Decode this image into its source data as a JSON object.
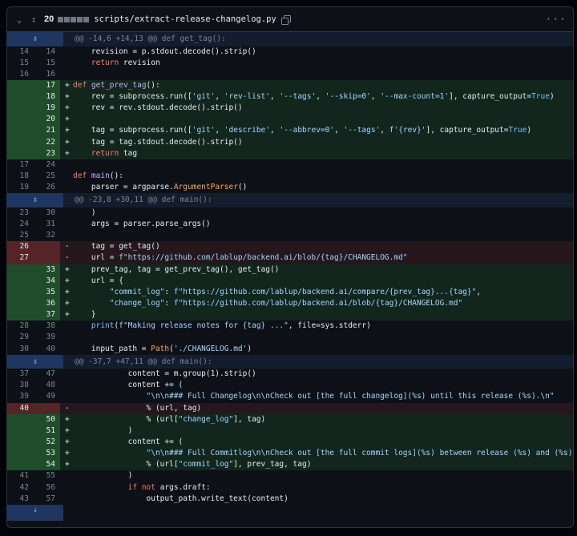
{
  "header": {
    "changes_count": "20",
    "file_path": "scripts/extract-release-changelog.py",
    "more_label": "···",
    "icons": [
      "chevron-down-icon",
      "unfold-icon",
      "copy-icon",
      "kebab-icon"
    ]
  },
  "colors": {
    "addition_bg": "#12261e",
    "addition_gutter": "#1f4d2b",
    "deletion_bg": "#25171c",
    "deletion_gutter": "#542426",
    "hunk_bg": "#131d2e",
    "keyword": "#ff7b72",
    "function": "#d2a8ff",
    "string": "#a5d6ff"
  },
  "lines": [
    {
      "type": "hunk",
      "text": "@@ -14,6 +14,13 @@ def get_tag():"
    },
    {
      "type": "ctx",
      "old": "14",
      "new": "14",
      "sign": "",
      "code": [
        [
          "",
          "    revision = p.stdout.decode().strip()"
        ]
      ]
    },
    {
      "type": "ctx",
      "old": "15",
      "new": "15",
      "sign": "",
      "code": [
        [
          "",
          "    "
        ],
        [
          "kw",
          "return"
        ],
        [
          "",
          " revision"
        ]
      ]
    },
    {
      "type": "ctx",
      "old": "16",
      "new": "16",
      "sign": "",
      "code": [
        [
          "",
          ""
        ]
      ]
    },
    {
      "type": "add",
      "old": "",
      "new": "17",
      "sign": "+",
      "code": [
        [
          "kw",
          "def"
        ],
        [
          "",
          " "
        ],
        [
          "fn",
          "get_prev_tag"
        ],
        [
          "",
          "():"
        ]
      ]
    },
    {
      "type": "add",
      "old": "",
      "new": "18",
      "sign": "+",
      "code": [
        [
          "",
          "    rev = subprocess.run(["
        ],
        [
          "st",
          "'git'"
        ],
        [
          "",
          ", "
        ],
        [
          "st",
          "'rev-list'"
        ],
        [
          "",
          ", "
        ],
        [
          "st",
          "'--tags'"
        ],
        [
          "",
          ", "
        ],
        [
          "st",
          "'--skip=0'"
        ],
        [
          "",
          ", "
        ],
        [
          "st",
          "'--max-count=1'"
        ],
        [
          "",
          "], capture_output="
        ],
        [
          "co",
          "True"
        ],
        [
          "",
          ")"
        ]
      ]
    },
    {
      "type": "add",
      "old": "",
      "new": "19",
      "sign": "+",
      "code": [
        [
          "",
          "    rev = rev.stdout.decode().strip()"
        ]
      ]
    },
    {
      "type": "add",
      "old": "",
      "new": "20",
      "sign": "+",
      "code": [
        [
          "",
          ""
        ]
      ]
    },
    {
      "type": "add",
      "old": "",
      "new": "21",
      "sign": "+",
      "code": [
        [
          "",
          "    tag = subprocess.run(["
        ],
        [
          "st",
          "'git'"
        ],
        [
          "",
          ", "
        ],
        [
          "st",
          "'describe'"
        ],
        [
          "",
          ", "
        ],
        [
          "st",
          "'--abbrev=0'"
        ],
        [
          "",
          ", "
        ],
        [
          "st",
          "'--tags'"
        ],
        [
          "",
          ", "
        ],
        [
          "st",
          "f'{rev}'"
        ],
        [
          "",
          "], capture_output="
        ],
        [
          "co",
          "True"
        ],
        [
          "",
          ")"
        ]
      ]
    },
    {
      "type": "add",
      "old": "",
      "new": "22",
      "sign": "+",
      "code": [
        [
          "",
          "    tag = tag.stdout.decode().strip()"
        ]
      ]
    },
    {
      "type": "add",
      "old": "",
      "new": "23",
      "sign": "+",
      "code": [
        [
          "",
          "    "
        ],
        [
          "kw",
          "return"
        ],
        [
          "",
          " tag"
        ]
      ]
    },
    {
      "type": "ctx",
      "old": "17",
      "new": "24",
      "sign": "",
      "code": [
        [
          "",
          ""
        ]
      ]
    },
    {
      "type": "ctx",
      "old": "18",
      "new": "25",
      "sign": "",
      "code": [
        [
          "kw",
          "def"
        ],
        [
          "",
          " "
        ],
        [
          "fn",
          "main"
        ],
        [
          "",
          "():"
        ]
      ]
    },
    {
      "type": "ctx",
      "old": "19",
      "new": "26",
      "sign": "",
      "code": [
        [
          "",
          "    parser = argparse."
        ],
        [
          "cl",
          "ArgumentParser"
        ],
        [
          "",
          "()"
        ]
      ]
    },
    {
      "type": "hunk",
      "text": "@@ -23,8 +30,11 @@ def main():"
    },
    {
      "type": "ctx",
      "old": "23",
      "new": "30",
      "sign": "",
      "code": [
        [
          "",
          "    )"
        ]
      ]
    },
    {
      "type": "ctx",
      "old": "24",
      "new": "31",
      "sign": "",
      "code": [
        [
          "",
          "    args = parser.parse_args()"
        ]
      ]
    },
    {
      "type": "ctx",
      "old": "25",
      "new": "32",
      "sign": "",
      "code": [
        [
          "",
          ""
        ]
      ]
    },
    {
      "type": "del",
      "old": "26",
      "new": "",
      "sign": "-",
      "code": [
        [
          "",
          "    tag = get_tag()"
        ]
      ]
    },
    {
      "type": "del",
      "old": "27",
      "new": "",
      "sign": "-",
      "code": [
        [
          "",
          "    url = "
        ],
        [
          "st",
          "f\"https://github.com/lablup/backend.ai/blob/{tag}/CHANGELOG.md\""
        ]
      ]
    },
    {
      "type": "add",
      "old": "",
      "new": "33",
      "sign": "+",
      "code": [
        [
          "",
          "    prev_tag, tag = get_prev_tag(), get_tag()"
        ]
      ]
    },
    {
      "type": "add",
      "old": "",
      "new": "34",
      "sign": "+",
      "code": [
        [
          "",
          "    url = {"
        ]
      ]
    },
    {
      "type": "add",
      "old": "",
      "new": "35",
      "sign": "+",
      "code": [
        [
          "",
          "        "
        ],
        [
          "st",
          "\"commit_log\""
        ],
        [
          "",
          ": "
        ],
        [
          "st",
          "f\"https://github.com/lablup/backend.ai/compare/{prev_tag}...{tag}\""
        ],
        [
          "",
          ","
        ]
      ]
    },
    {
      "type": "add",
      "old": "",
      "new": "36",
      "sign": "+",
      "code": [
        [
          "",
          "        "
        ],
        [
          "st",
          "\"change_log\""
        ],
        [
          "",
          ": "
        ],
        [
          "st",
          "f\"https://github.com/lablup/backend.ai/blob/{tag}/CHANGELOG.md\""
        ]
      ]
    },
    {
      "type": "add",
      "old": "",
      "new": "37",
      "sign": "+",
      "code": [
        [
          "",
          "    }"
        ]
      ]
    },
    {
      "type": "ctx",
      "old": "28",
      "new": "38",
      "sign": "",
      "code": [
        [
          "",
          "    "
        ],
        [
          "co",
          "print"
        ],
        [
          "",
          "("
        ],
        [
          "st",
          "f\"Making release notes for {tag} ...\""
        ],
        [
          "",
          ", file=sys.stderr)"
        ]
      ]
    },
    {
      "type": "ctx",
      "old": "29",
      "new": "39",
      "sign": "",
      "code": [
        [
          "",
          ""
        ]
      ]
    },
    {
      "type": "ctx",
      "old": "30",
      "new": "40",
      "sign": "",
      "code": [
        [
          "",
          "    input_path = "
        ],
        [
          "cl",
          "Path"
        ],
        [
          "",
          "("
        ],
        [
          "st",
          "'./CHANGELOG.md'"
        ],
        [
          "",
          ")"
        ]
      ]
    },
    {
      "type": "hunk",
      "text": "@@ -37,7 +47,11 @@ def main():"
    },
    {
      "type": "ctx",
      "old": "37",
      "new": "47",
      "sign": "",
      "code": [
        [
          "",
          "            content = m.group(1).strip()"
        ]
      ]
    },
    {
      "type": "ctx",
      "old": "38",
      "new": "48",
      "sign": "",
      "code": [
        [
          "",
          "            content += ("
        ]
      ]
    },
    {
      "type": "ctx",
      "old": "39",
      "new": "49",
      "sign": "",
      "code": [
        [
          "",
          "                "
        ],
        [
          "st",
          "\"\\n\\n### Full Changelog\\n\\nCheck out [the full changelog](%s) until this release (%s).\\n\""
        ]
      ]
    },
    {
      "type": "del",
      "old": "40",
      "new": "",
      "sign": "-",
      "code": [
        [
          "",
          "                % (url, tag)"
        ]
      ]
    },
    {
      "type": "add",
      "old": "",
      "new": "50",
      "sign": "+",
      "code": [
        [
          "",
          "                % (url["
        ],
        [
          "st",
          "\"change_log\""
        ],
        [
          "",
          "], tag)"
        ]
      ]
    },
    {
      "type": "add",
      "old": "",
      "new": "51",
      "sign": "+",
      "code": [
        [
          "",
          "            )"
        ]
      ]
    },
    {
      "type": "add",
      "old": "",
      "new": "52",
      "sign": "+",
      "code": [
        [
          "",
          "            content += ("
        ]
      ]
    },
    {
      "type": "add",
      "old": "",
      "new": "53",
      "sign": "+",
      "code": [
        [
          "",
          "                "
        ],
        [
          "st",
          "\"\\n\\n### Full Commitlog\\n\\nCheck out [the full commit logs](%s) between release (%s) and (%s).\\n\""
        ]
      ]
    },
    {
      "type": "add",
      "old": "",
      "new": "54",
      "sign": "+",
      "code": [
        [
          "",
          "                % (url["
        ],
        [
          "st",
          "\"commit_log\""
        ],
        [
          "",
          "], prev_tag, tag)"
        ]
      ]
    },
    {
      "type": "ctx",
      "old": "41",
      "new": "55",
      "sign": "",
      "code": [
        [
          "",
          "            )"
        ]
      ]
    },
    {
      "type": "ctx",
      "old": "42",
      "new": "56",
      "sign": "",
      "code": [
        [
          "",
          "            "
        ],
        [
          "kw",
          "if"
        ],
        [
          "",
          " "
        ],
        [
          "kw",
          "not"
        ],
        [
          "",
          " args.draft:"
        ]
      ]
    },
    {
      "type": "ctx",
      "old": "43",
      "new": "57",
      "sign": "",
      "code": [
        [
          "",
          "                output_path.write_text(content)"
        ]
      ]
    },
    {
      "type": "endhunk",
      "text": ""
    }
  ]
}
